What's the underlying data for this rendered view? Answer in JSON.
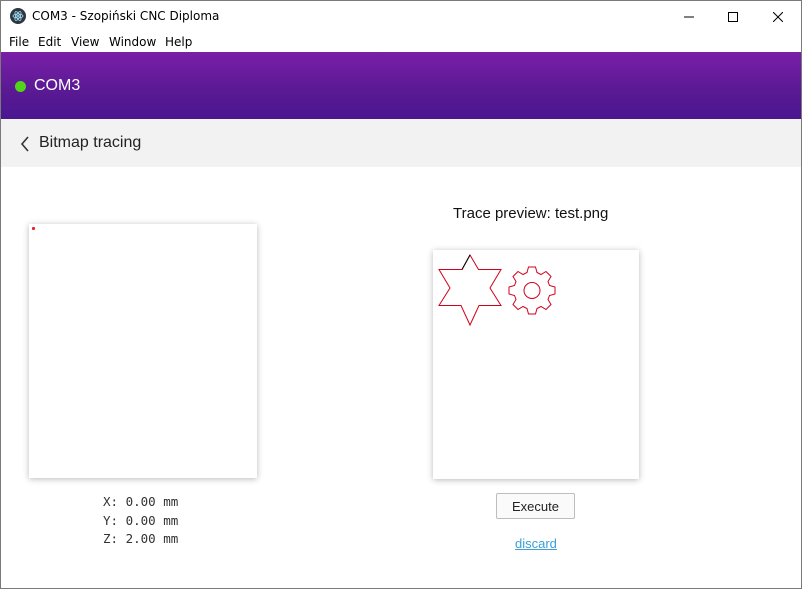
{
  "window": {
    "title": "COM3 - Szopiński CNC Diploma",
    "app_icon": "electron-icon",
    "controls": [
      "minimize-icon",
      "maximize-icon",
      "close-icon"
    ]
  },
  "menu": {
    "items": [
      {
        "label": "File"
      },
      {
        "label": "Edit"
      },
      {
        "label": "View"
      },
      {
        "label": "Window"
      },
      {
        "label": "Help"
      }
    ]
  },
  "header": {
    "port": "COM3",
    "status_color": "#52d41a",
    "accent_color": "#6a1b9a"
  },
  "subheader": {
    "back_icon": "chevron-left-icon",
    "title": "Bitmap tracing"
  },
  "position": {
    "x": "X: 0.00 mm",
    "y": "Y: 0.00 mm",
    "z": "Z: 2.00 mm"
  },
  "preview": {
    "title": "Trace preview: test.png",
    "trace_color": "#d0021b",
    "shapes": [
      "star-shape",
      "gear-shape"
    ]
  },
  "actions": {
    "execute_label": "Execute",
    "discard_label": "discard",
    "link_color": "#3aa0d8"
  }
}
